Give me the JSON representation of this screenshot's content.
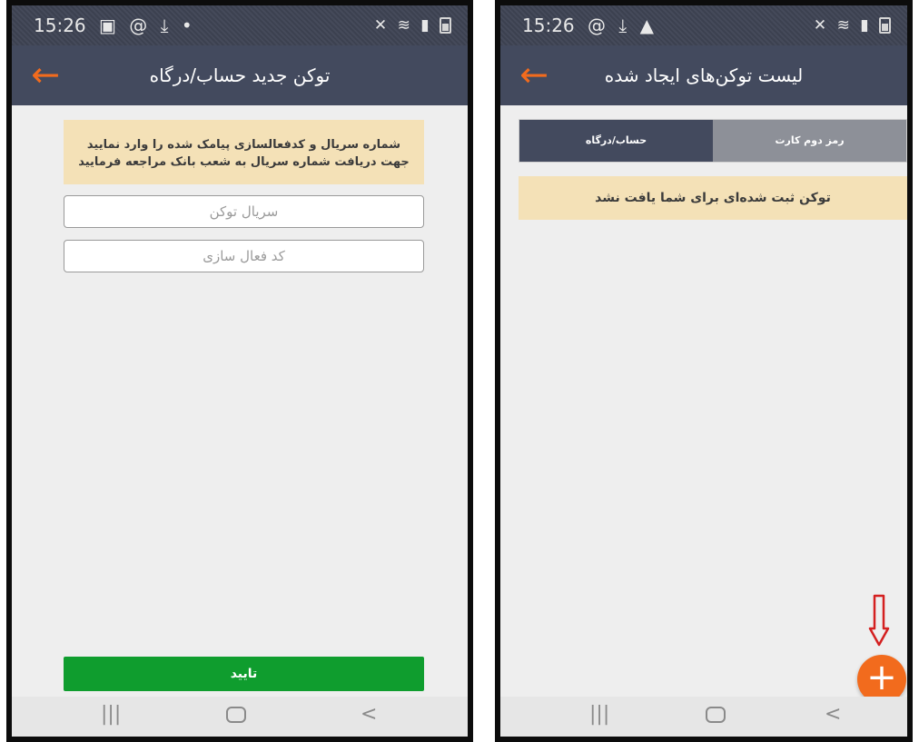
{
  "left_screen": {
    "status_bar": {
      "time": "15:26",
      "left_icons": [
        "gallery-icon",
        "at-sign-icon",
        "download-icon",
        "dot-icon"
      ],
      "right_icons": [
        "mute-icon",
        "wifi-icon",
        "signal-icon",
        "battery-icon"
      ]
    },
    "title": "توکن جدید حساب/درگاه",
    "notice_line1": "شماره سریال و کدفعالسازی پیامک شده را وارد نمایید",
    "notice_line2": "جهت دریافت شماره سریال به شعب بانک مراجعه فرمایید",
    "serial_placeholder": "سریال توکن",
    "activation_placeholder": "کد فعال سازی",
    "confirm_label": "تایید",
    "nav": {
      "recent": "|||",
      "home": "○",
      "back": "<"
    }
  },
  "right_screen": {
    "status_bar": {
      "time": "15:26",
      "left_icons": [
        "at-sign-icon",
        "download-icon",
        "warning-icon"
      ],
      "right_icons": [
        "mute-icon",
        "wifi-icon",
        "signal-icon",
        "battery-icon"
      ]
    },
    "title": "لیست توکن‌های ایجاد شده",
    "tabs": [
      {
        "label": "حساب/درگاه",
        "active": true
      },
      {
        "label": "رمز دوم کارت",
        "active": false
      }
    ],
    "empty_message": "توکن ثبت شده‌ای برای شما یافت نشد",
    "fab_label": "+",
    "nav": {
      "recent": "|||",
      "home": "○",
      "back": "<"
    }
  },
  "colors": {
    "app_bar": "#434a5e",
    "accent": "#f26b1d",
    "notice_bg": "#f4e1b7",
    "confirm_green": "#0f9d2e",
    "tab_inactive": "#8d9098",
    "background": "#eeeeee",
    "pointer_arrow": "#d42020"
  }
}
